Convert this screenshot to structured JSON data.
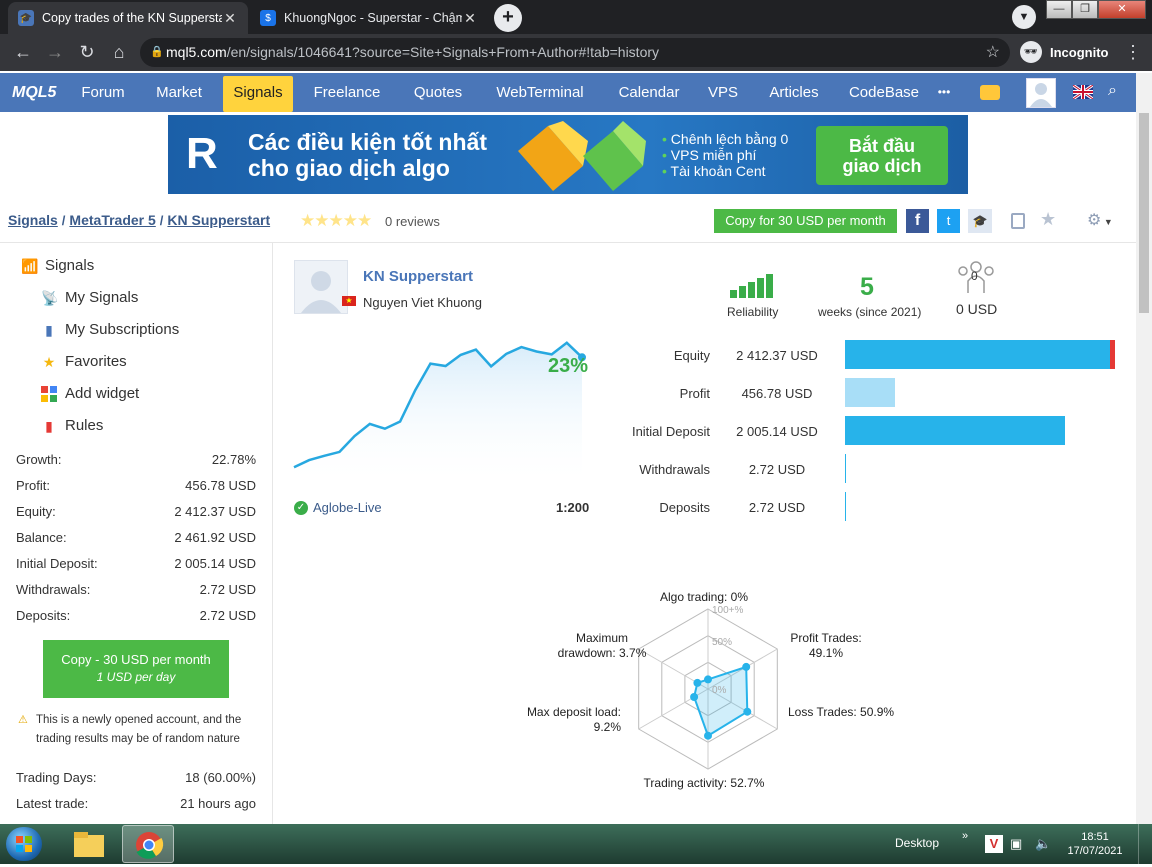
{
  "browser": {
    "tabs": [
      {
        "title": "Copy trades of the KN Supperstart",
        "active": true
      },
      {
        "title": "KhuongNgoc - Superstar - Chậm",
        "active": false
      }
    ],
    "new_tab": "+",
    "url_host": "mql5.com",
    "url_path": "/en/signals/1046641?source=Site+Signals+From+Author#!tab=history",
    "incognito_label": "Incognito",
    "window_controls": [
      "—",
      "❐",
      "✕"
    ]
  },
  "nav": {
    "logo": "MQL5",
    "items": [
      "Forum",
      "Market",
      "Signals",
      "Freelance",
      "Quotes",
      "WebTerminal",
      "Calendar",
      "VPS",
      "Articles",
      "CodeBase"
    ],
    "selected": "Signals",
    "more": "•••",
    "lang_flag": "gb-flag"
  },
  "banner": {
    "logo_letter": "R",
    "headline_1": "Các điều kiện tốt nhất",
    "headline_2": "cho giao dịch algo",
    "bullets": [
      "Chênh lệch bằng 0",
      "VPS miễn phí",
      "Tài khoản Cent"
    ],
    "cta_1": "Bắt đầu",
    "cta_2": "giao dịch"
  },
  "breadcrumb": {
    "items": [
      "Signals",
      "MetaTrader 5",
      "KN Supperstart"
    ],
    "separator": "/",
    "reviews": "0 reviews",
    "copy_button": "Copy for 30 USD per month",
    "rating_stars": 0
  },
  "sidebar": {
    "menu": [
      {
        "label": "Signals",
        "icon": "antenna-icon"
      },
      {
        "label": "My Signals",
        "icon": "radio-icon"
      },
      {
        "label": "My Subscriptions",
        "icon": "subscriptions-icon"
      },
      {
        "label": "Favorites",
        "icon": "star-icon"
      },
      {
        "label": "Add widget",
        "icon": "widget-icon"
      },
      {
        "label": "Rules",
        "icon": "bookmark-icon"
      }
    ],
    "stats": [
      {
        "k": "Growth:",
        "v": "22.78%"
      },
      {
        "k": "Profit:",
        "v": "456.78 USD"
      },
      {
        "k": "Equity:",
        "v": "2 412.37 USD"
      },
      {
        "k": "Balance:",
        "v": "2 461.92 USD"
      },
      {
        "k": "Initial Deposit:",
        "v": "2 005.14 USD"
      },
      {
        "k": "Withdrawals:",
        "v": "2.72 USD"
      },
      {
        "k": "Deposits:",
        "v": "2.72 USD"
      }
    ],
    "copy_line1": "Copy - 30 USD per month",
    "copy_line2": "1 USD per day",
    "warning": "This is a newly opened account, and the trading results may be of random nature",
    "stats2": [
      {
        "k": "Trading Days:",
        "v": "18 (60.00%)"
      },
      {
        "k": "Latest trade:",
        "v": "21 hours ago"
      }
    ]
  },
  "signal": {
    "name": "KN Supperstart",
    "author": "Nguyen Viet Khuong",
    "growth": "23%",
    "server": "Aglobe-Live",
    "leverage": "1:200",
    "reliability_label": "Reliability",
    "weeks": "5",
    "weeks_label": "weeks (since 2021)",
    "subscribers": "0",
    "subscribers_usd": "0 USD"
  },
  "bars": [
    {
      "label": "Equity",
      "value": "2 412.37 USD",
      "amount": 2412.37,
      "color": "#27b3ea"
    },
    {
      "label": "Profit",
      "value": "456.78 USD",
      "amount": 456.78,
      "color": "#a8def7"
    },
    {
      "label": "Initial Deposit",
      "value": "2 005.14 USD",
      "amount": 2005.14,
      "color": "#27b3ea"
    },
    {
      "label": "Withdrawals",
      "value": "2.72 USD",
      "amount": 2.72,
      "color": "#27b3ea"
    },
    {
      "label": "Deposits",
      "value": "2.72 USD",
      "amount": 2.72,
      "color": "#27b3ea"
    }
  ],
  "chart_data": {
    "type": "line",
    "y": [
      0.0,
      1.5,
      2.4,
      3.2,
      6.5,
      9.0,
      8.0,
      9.5,
      16.0,
      21.5,
      21.0,
      23.3,
      24.4,
      20.9,
      23.5,
      24.9,
      24.0,
      23.4,
      25.8,
      22.8
    ],
    "label": "23%"
  },
  "radar": {
    "scale_labels": [
      "100+%",
      "50%",
      "0%"
    ],
    "axes": [
      {
        "label": "Algo trading: 0%",
        "value": 0
      },
      {
        "label": "Profit Trades:",
        "label2": "49.1%",
        "value": 49.1
      },
      {
        "label": "Loss Trades: 50.9%",
        "value": 50.9
      },
      {
        "label": "Trading activity: 52.7%",
        "value": 52.7
      },
      {
        "label": "Max deposit load:",
        "label2": "9.2%",
        "value": 9.2
      },
      {
        "label": "Maximum",
        "label2": "drawdown: 3.7%",
        "value": 3.7
      }
    ]
  },
  "taskbar": {
    "desktop": "Desktop",
    "time": "18:51",
    "date": "17/07/2021"
  }
}
